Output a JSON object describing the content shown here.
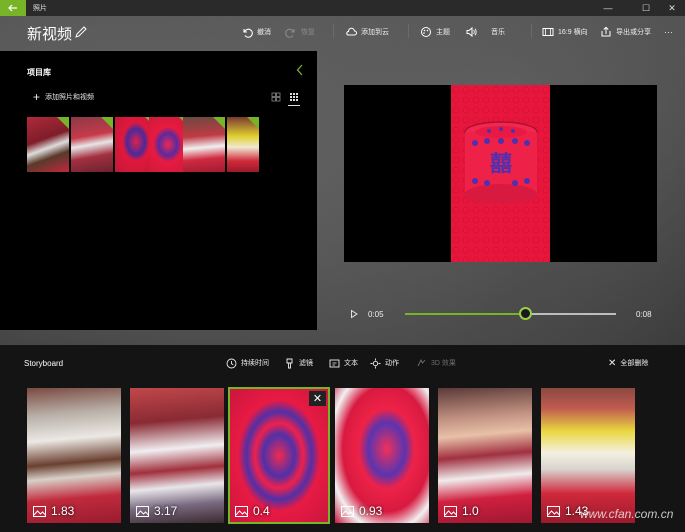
{
  "window": {
    "app_title": "照片",
    "back_icon": "back-arrow-icon",
    "controls": [
      "minimize-icon",
      "maximize-icon",
      "close-icon"
    ]
  },
  "header": {
    "project_title": "新视频",
    "edit_icon": "pencil-icon",
    "toolbar": {
      "undo": "撤消",
      "redo": "恢复",
      "add_cloud": "添加到云",
      "theme": "主题",
      "music": "音乐",
      "aspect": "16:9 横向",
      "export": "导出或分享",
      "more": "···"
    }
  },
  "library": {
    "title": "项目库",
    "add_label": "添加照片和视频",
    "collapse_icon": "chevron-left-icon",
    "view_modes": [
      "large-grid-icon",
      "small-grid-icon"
    ],
    "active_view": "small-grid-icon",
    "thumbnails": [
      "plate-of-food",
      "dining-table",
      "red-candy-box",
      "red-candy-box-closeup",
      "table-setting",
      "juice-glass"
    ]
  },
  "preview": {
    "current_time": "0:05",
    "total_time": "0:08",
    "progress": 0.57,
    "play_icon": "play-icon"
  },
  "storyboard": {
    "title": "Storyboard",
    "tools": {
      "duration": "持续时间",
      "filters": "滤镜",
      "text": "文本",
      "motion": "动作",
      "effects3d": "3D 效果"
    },
    "remove_all": "全部删除",
    "clips": [
      {
        "duration": "1.83",
        "subject": "plate-of-food"
      },
      {
        "duration": "3.17",
        "subject": "banquet-hall"
      },
      {
        "duration": "0.4",
        "subject": "red-candy-box",
        "selected": true
      },
      {
        "duration": "0.93",
        "subject": "red-candy-box-side"
      },
      {
        "duration": "1.0",
        "subject": "children-at-table"
      },
      {
        "duration": "1.43",
        "subject": "juice-glass"
      }
    ]
  },
  "watermark": "www.cfan.com.cn",
  "colors": {
    "accent": "#78b428",
    "panel": "#000000",
    "storyboard": "#141414"
  }
}
